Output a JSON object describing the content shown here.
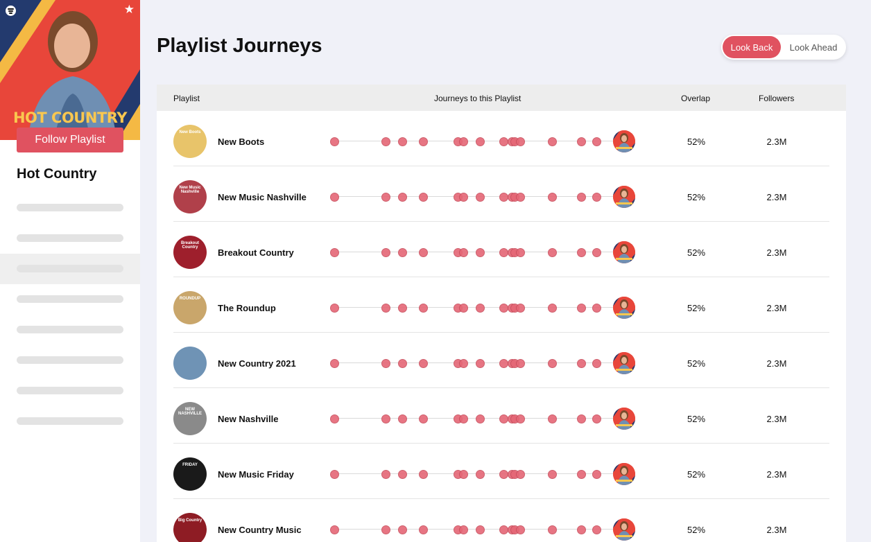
{
  "sidebar": {
    "cover_title": "HOT COUNTRY",
    "follow_label": "Follow Playlist",
    "playlist_title": "Hot Country",
    "skeleton_count": 8,
    "active_index": 2
  },
  "header": {
    "title": "Playlist Journeys",
    "toggle": {
      "back_label": "Look Back",
      "ahead_label": "Look Ahead",
      "selected": "Look Back"
    }
  },
  "table": {
    "columns": {
      "playlist": "Playlist",
      "journeys": "Journeys to this Playlist",
      "overlap": "Overlap",
      "followers": "Followers"
    },
    "rows": [
      {
        "name": "New Boots",
        "thumb_text": "New Boots",
        "thumb_bg": "#e8c46a",
        "overlap": "52%",
        "followers": "2.3M"
      },
      {
        "name": "New Music Nashville",
        "thumb_text": "New Music Nashville",
        "thumb_bg": "#b0404a",
        "overlap": "52%",
        "followers": "2.3M"
      },
      {
        "name": "Breakout Country",
        "thumb_text": "Breakout Country",
        "thumb_bg": "#9e1f2c",
        "overlap": "52%",
        "followers": "2.3M"
      },
      {
        "name": "The Roundup",
        "thumb_text": "ROUNDUP",
        "thumb_bg": "#c9a66b",
        "overlap": "52%",
        "followers": "2.3M"
      },
      {
        "name": "New Country 2021",
        "thumb_text": "",
        "thumb_bg": "#6f93b5",
        "overlap": "52%",
        "followers": "2.3M"
      },
      {
        "name": "New Nashville",
        "thumb_text": "NEW NASHVILLE",
        "thumb_bg": "#8a8a8a",
        "overlap": "52%",
        "followers": "2.3M"
      },
      {
        "name": "New Music Friday",
        "thumb_text": "FRIDAY",
        "thumb_bg": "#1a1a1a",
        "overlap": "52%",
        "followers": "2.3M"
      },
      {
        "name": "New Country Music",
        "thumb_text": "Big Country",
        "thumb_bg": "#8e1c24",
        "overlap": "52%",
        "followers": "2.3M"
      }
    ]
  },
  "colors": {
    "accent": "#e05260",
    "dot": "#e56776",
    "page_bg": "#f0f1f8"
  },
  "icons": {
    "logo": "spotify-logo-icon",
    "star": "star-icon"
  }
}
